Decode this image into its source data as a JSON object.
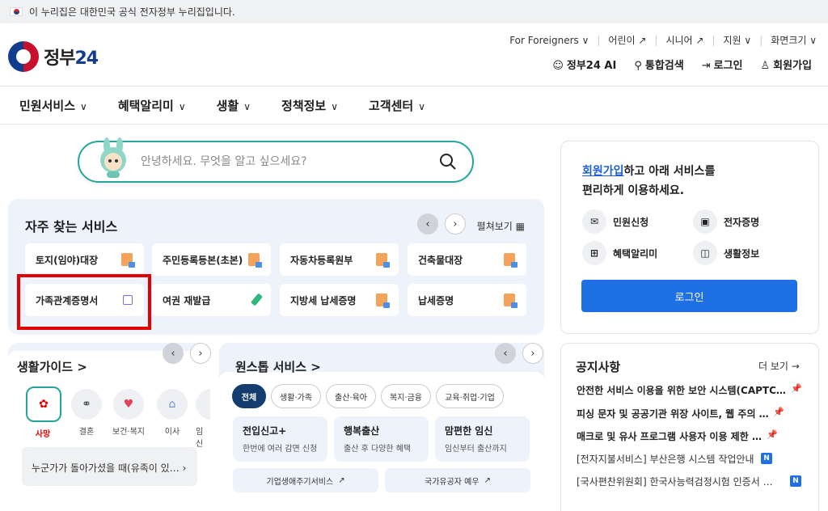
{
  "banner": {
    "text": "이 누리집은 대한민국 공식 전자정부 누리집입니다."
  },
  "logo": {
    "text": "정부",
    "num": "24"
  },
  "utility": [
    {
      "label": "For Foreigners ∨"
    },
    {
      "label": "어린이 ↗"
    },
    {
      "label": "시니어 ↗"
    },
    {
      "label": "지원 ∨"
    },
    {
      "label": "화면크기 ∨"
    }
  ],
  "actions": {
    "ai": "정부24 AI",
    "search": "통합검색",
    "login": "로그인",
    "signup": "회원가입"
  },
  "gnb": [
    "민원서비스",
    "혜택알리미",
    "생활",
    "정책정보",
    "고객센터"
  ],
  "search": {
    "placeholder": "안녕하세요. 무엇을 알고 싶으세요?"
  },
  "favorites": {
    "title": "자주 찾는 서비스",
    "view_all": "펼쳐보기 ▦",
    "tiles": [
      "토지(임야)대장",
      "주민등록등본(초본)",
      "자동차등록원부",
      "건축물대장",
      "가족관계증명서",
      "여권 재발급",
      "지방세 납세증명",
      "납세증명"
    ]
  },
  "life_guide": {
    "title": "생활가이드 >",
    "categories": [
      "사망",
      "결혼",
      "보건·복지",
      "이사",
      "임신"
    ],
    "item": "누군가가 돌아가셨을 때(유족이 있…"
  },
  "onestop": {
    "title": "원스톱 서비스 >",
    "chips": [
      "전체",
      "생활·가족",
      "출산·육아",
      "복지·금융",
      "교육·취업·기업"
    ],
    "services": [
      {
        "title": "전입신고+",
        "desc": "한번에 여러 감면 신청"
      },
      {
        "title": "행복출산",
        "desc": "출산 후 다양한 혜택"
      },
      {
        "title": "맘편한 임신",
        "desc": "임신부터 출산까지"
      }
    ],
    "links": [
      "기업생애주기서비스",
      "국가유공자 예우"
    ]
  },
  "member_panel": {
    "link": "회원가입",
    "msg1": "하고 아래 서비스를",
    "msg2": "편리하게 이용하세요.",
    "items": [
      "민원신청",
      "전자증명",
      "혜택알리미",
      "생활정보"
    ],
    "login_button": "로그인"
  },
  "notices": {
    "title": "공지사항",
    "more": "더 보기 →",
    "items": [
      "안전한 서비스 이용을 위한 보안 시스템(CAPTCH…",
      "피싱 문자 및 공공기관 위장 사이트, 웹 주의 안내",
      "매크로 및 유사 프로그램 사용자 이용 제한 안내",
      "[전자지불서비스] 부산은행 시스템 작업안내",
      "[국사편찬위원회] 한국사능력검정시험 인증서 모…"
    ],
    "badge": "N"
  }
}
